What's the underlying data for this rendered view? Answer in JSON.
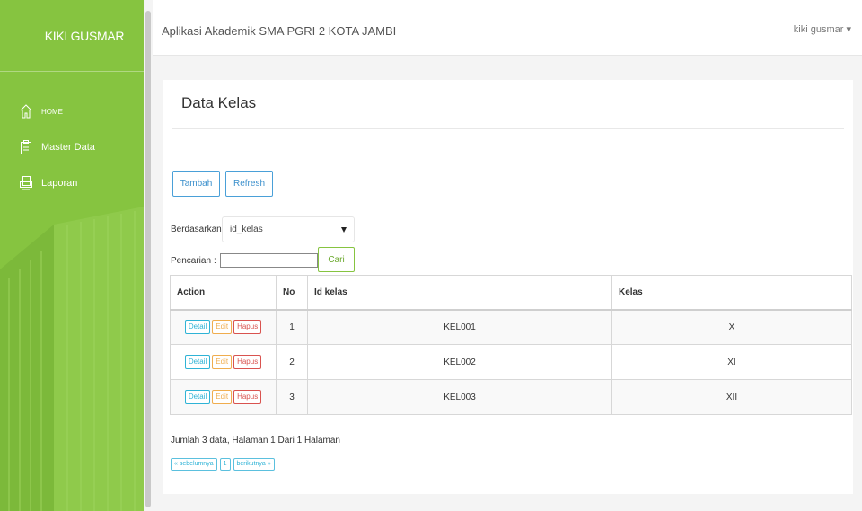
{
  "sidebar": {
    "brand": "KIKI GUSMAR",
    "items": [
      {
        "label": "HOME",
        "icon": "home-icon"
      },
      {
        "label": "Master Data",
        "icon": "clipboard-icon"
      },
      {
        "label": "Laporan",
        "icon": "report-icon"
      }
    ]
  },
  "header": {
    "title": "Aplikasi Akademik SMA PGRI 2 KOTA JAMBI",
    "user": "kiki gusmar ▾"
  },
  "page": {
    "title": "Data Kelas",
    "add_label": "Tambah",
    "refresh_label": "Refresh",
    "filter_label": "Berdasarkan:",
    "filter_value": "id_kelas",
    "search_label": "Pencarian",
    "search_sep": ":",
    "search_value": "",
    "search_button": "Cari"
  },
  "table": {
    "headers": [
      "Action",
      "No",
      "Id kelas",
      "Kelas"
    ],
    "actions": {
      "detail": "Detail",
      "edit": "Edit",
      "hapus": "Hapus"
    },
    "rows": [
      {
        "no": "1",
        "id_kelas": "KEL001",
        "kelas": "X"
      },
      {
        "no": "2",
        "id_kelas": "KEL002",
        "kelas": "XI"
      },
      {
        "no": "3",
        "id_kelas": "KEL003",
        "kelas": "XII"
      }
    ]
  },
  "footer": {
    "summary": "Jumlah 3 data, Halaman 1 Dari 1 Halaman",
    "prev": "« sebelumnya",
    "page": "1",
    "next": "berikutnya »"
  },
  "colors": {
    "sidebar": "#86c440",
    "primary": "#4aa0d8",
    "success": "#86c440",
    "info": "#5bc0de",
    "warning": "#f0ad4e",
    "danger": "#d9534f"
  }
}
